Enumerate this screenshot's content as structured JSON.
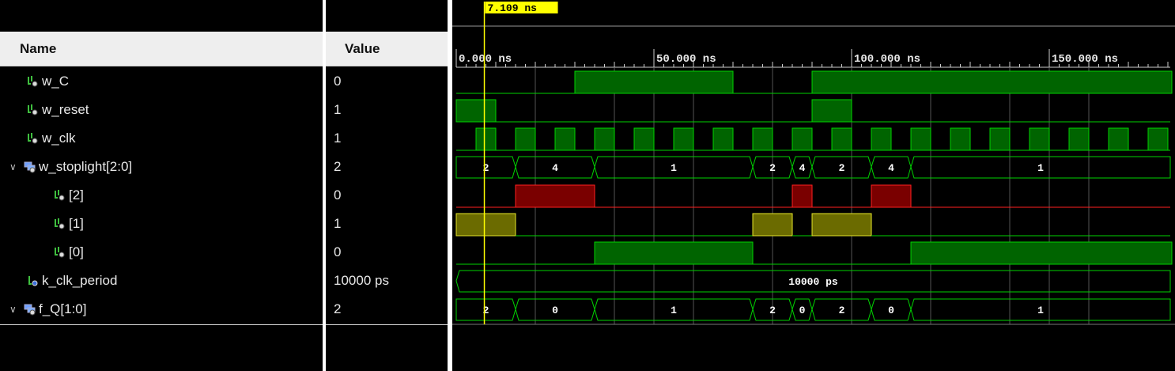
{
  "columns": {
    "name": "Name",
    "value": "Value"
  },
  "cursor": {
    "label": "7.109 ns"
  },
  "timeline": {
    "ticks": [
      "0.000 ns",
      "50.000 ns",
      "100.000 ns",
      "150.000 ns"
    ]
  },
  "signals": [
    {
      "name": "w_C",
      "value": "0",
      "icon": "logic-signal-icon",
      "expandable": false,
      "indent": 0
    },
    {
      "name": "w_reset",
      "value": "1",
      "icon": "logic-signal-icon",
      "expandable": false,
      "indent": 0
    },
    {
      "name": "w_clk",
      "value": "1",
      "icon": "logic-signal-icon",
      "expandable": false,
      "indent": 0
    },
    {
      "name": "w_stoplight[2:0]",
      "value": "2",
      "icon": "bus-signal-icon",
      "expandable": true,
      "indent": 0
    },
    {
      "name": "[2]",
      "value": "0",
      "icon": "logic-signal-icon",
      "expandable": false,
      "indent": 1
    },
    {
      "name": "[1]",
      "value": "1",
      "icon": "logic-signal-icon",
      "expandable": false,
      "indent": 1
    },
    {
      "name": "[0]",
      "value": "0",
      "icon": "logic-signal-icon",
      "expandable": false,
      "indent": 1
    },
    {
      "name": "k_clk_period",
      "value": "10000 ps",
      "icon": "constant-signal-icon",
      "expandable": false,
      "indent": 0
    },
    {
      "name": "f_Q[1:0]",
      "value": "2",
      "icon": "bus-signal-icon",
      "expandable": true,
      "indent": 0
    }
  ],
  "waveforms": {
    "time_range_ns": [
      0,
      181
    ],
    "cursor_ns": 7.109,
    "w_C_high": [
      [
        30,
        70
      ],
      [
        90,
        181
      ]
    ],
    "w_reset_high": [
      [
        0,
        10
      ],
      [
        90,
        100
      ]
    ],
    "w_clk": {
      "first_rise_ns": 5,
      "period_ns": 10
    },
    "w_stoplight_segments": [
      {
        "from": 0,
        "to": 15,
        "label": "2"
      },
      {
        "from": 15,
        "to": 35,
        "label": "4"
      },
      {
        "from": 35,
        "to": 75,
        "label": "1"
      },
      {
        "from": 75,
        "to": 85,
        "label": "2"
      },
      {
        "from": 85,
        "to": 90,
        "label": "4"
      },
      {
        "from": 90,
        "to": 105,
        "label": "2"
      },
      {
        "from": 105,
        "to": 115,
        "label": "4"
      },
      {
        "from": 115,
        "to": 181,
        "label": "1"
      }
    ],
    "bit2_high": [
      [
        15,
        35
      ],
      [
        85,
        90
      ],
      [
        105,
        115
      ]
    ],
    "bit1_high": [
      [
        0,
        15
      ],
      [
        75,
        85
      ],
      [
        90,
        105
      ]
    ],
    "bit0_high": [
      [
        35,
        75
      ],
      [
        115,
        181
      ]
    ],
    "k_clk_period_label": "10000 ps",
    "f_Q_segments": [
      {
        "from": 0,
        "to": 15,
        "label": "2"
      },
      {
        "from": 15,
        "to": 35,
        "label": "0"
      },
      {
        "from": 35,
        "to": 75,
        "label": "1"
      },
      {
        "from": 75,
        "to": 85,
        "label": "2"
      },
      {
        "from": 85,
        "to": 90,
        "label": "0"
      },
      {
        "from": 90,
        "to": 105,
        "label": "2"
      },
      {
        "from": 105,
        "to": 115,
        "label": "0"
      },
      {
        "from": 115,
        "to": 181,
        "label": "1"
      }
    ]
  },
  "colors": {
    "logic": "#00d200",
    "logic_fill": "#006400",
    "bit2_fill": "#7a0000",
    "bit2_line": "#ff2020",
    "bit1_fill": "#6b6b00",
    "bit1_line": "#e5e52a",
    "cursor": "#ffff00",
    "grid": "#555555"
  }
}
